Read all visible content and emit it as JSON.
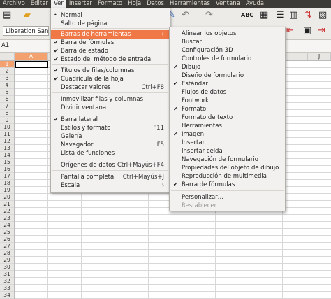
{
  "menubar": {
    "items": [
      "Archivo",
      "Editar",
      "Ver",
      "Insertar",
      "Formato",
      "Hoja",
      "Datos",
      "Herramientas",
      "Ventana",
      "Ayuda"
    ],
    "active": "Ver"
  },
  "toolbar": {
    "font_name": "Liberation Sans"
  },
  "namebox": {
    "value": "A1"
  },
  "sheet": {
    "columns": [
      "A",
      "",
      "",
      "",
      "",
      "",
      "",
      "",
      "I",
      "J"
    ],
    "rows": [
      "1",
      "2",
      "3",
      "4",
      "5",
      "6",
      "7",
      "8",
      "9",
      "10",
      "11",
      "12",
      "13",
      "14",
      "15",
      "16",
      "17",
      "18",
      "19",
      "20",
      "21",
      "22",
      "23",
      "24",
      "25",
      "26",
      "27",
      "28",
      "29",
      "30",
      "31",
      "32",
      "33",
      "34"
    ],
    "selected_cell": "A1"
  },
  "ver_menu": {
    "items": [
      {
        "label": "Normal",
        "mark": "•",
        "accel": ""
      },
      {
        "label": "Salto de página",
        "mark": "",
        "accel": ""
      },
      {
        "label": "Barras de herramientas",
        "mark": "",
        "accel": "›",
        "highlighted": true
      },
      {
        "label": "Barra de fórmulas",
        "mark": "✔",
        "accel": ""
      },
      {
        "label": "Barra de estado",
        "mark": "✔",
        "accel": ""
      },
      {
        "label": "Estado del método de entrada",
        "mark": "✔",
        "accel": ""
      },
      {
        "label": "Títulos de filas/columnas",
        "mark": "✔",
        "accel": ""
      },
      {
        "label": "Cuadrícula de la hoja",
        "mark": "✔",
        "accel": ""
      },
      {
        "label": "Destacar valores",
        "mark": "",
        "accel": "Ctrl+F8"
      },
      {
        "label": "Inmovilizar filas y columnas",
        "mark": "",
        "accel": ""
      },
      {
        "label": "Dividir ventana",
        "mark": "",
        "accel": ""
      },
      {
        "label": "Barra lateral",
        "mark": "✔",
        "accel": ""
      },
      {
        "label": "Estilos y formato",
        "mark": "",
        "accel": "F11"
      },
      {
        "label": "Galería",
        "mark": "",
        "accel": ""
      },
      {
        "label": "Navegador",
        "mark": "",
        "accel": "F5"
      },
      {
        "label": "Lista de funciones",
        "mark": "",
        "accel": ""
      },
      {
        "label": "Orígenes de datos",
        "mark": "",
        "accel": "Ctrl+Mayús+F4"
      },
      {
        "label": "Pantalla completa",
        "mark": "",
        "accel": "Ctrl+Mayús+J"
      },
      {
        "label": "Escala",
        "mark": "",
        "accel": "›"
      }
    ]
  },
  "toolbars_submenu": {
    "items": [
      {
        "label": "Alinear los objetos",
        "mark": ""
      },
      {
        "label": "Buscar",
        "mark": ""
      },
      {
        "label": "Configuración 3D",
        "mark": ""
      },
      {
        "label": "Controles de formulario",
        "mark": ""
      },
      {
        "label": "Dibujo",
        "mark": "✔"
      },
      {
        "label": "Diseño de formulario",
        "mark": ""
      },
      {
        "label": "Estándar",
        "mark": "✔"
      },
      {
        "label": "Flujos de datos",
        "mark": ""
      },
      {
        "label": "Fontwork",
        "mark": ""
      },
      {
        "label": "Formato",
        "mark": "✔"
      },
      {
        "label": "Formato de texto",
        "mark": ""
      },
      {
        "label": "Herramientas",
        "mark": ""
      },
      {
        "label": "Imagen",
        "mark": "✔"
      },
      {
        "label": "Insertar",
        "mark": ""
      },
      {
        "label": "Insertar celda",
        "mark": ""
      },
      {
        "label": "Navegación de formulario",
        "mark": ""
      },
      {
        "label": "Propiedades del objeto de dibujo",
        "mark": ""
      },
      {
        "label": "Reproducción de multimedia",
        "mark": ""
      },
      {
        "label": "Barra de fórmulas",
        "mark": "✔"
      },
      {
        "label": "Personalizar…",
        "mark": ""
      },
      {
        "label": "Restablecer",
        "mark": "",
        "disabled": true
      }
    ]
  },
  "colors": {
    "menubar_bg": "#3c3b37",
    "highlight": "#f07746",
    "selected_header": "#f3a26f"
  }
}
